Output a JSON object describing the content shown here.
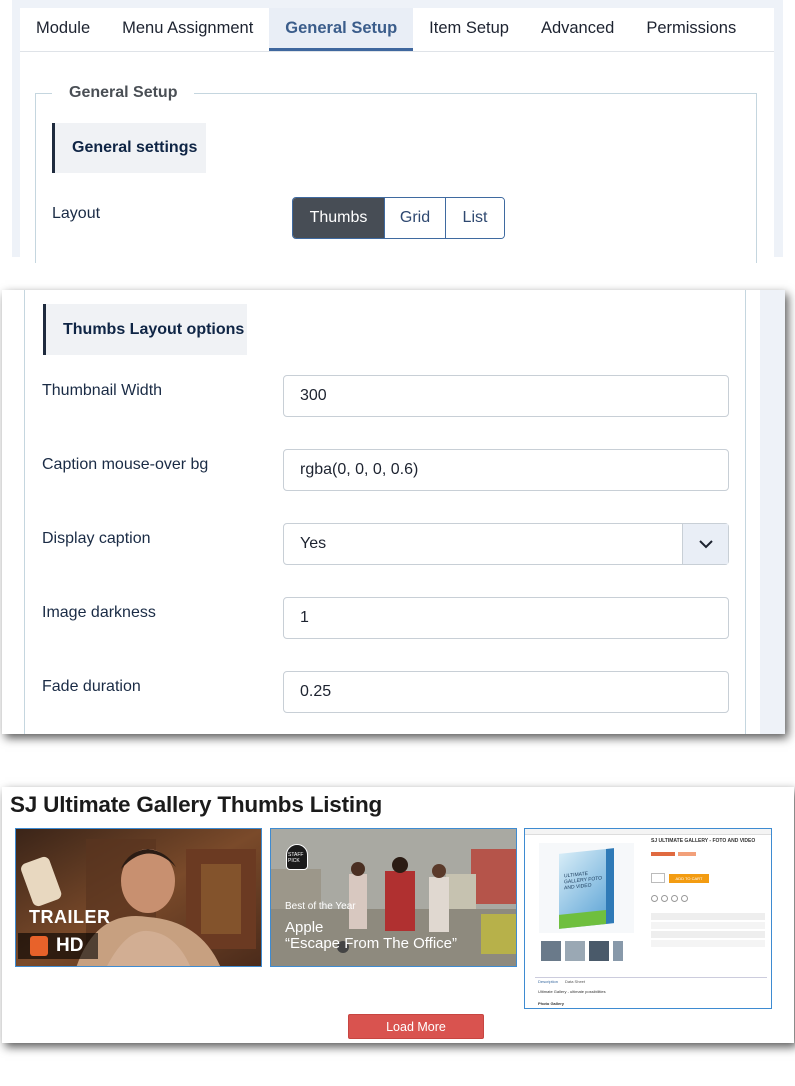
{
  "tabs": [
    "Module",
    "Menu Assignment",
    "General Setup",
    "Item Setup",
    "Advanced",
    "Permissions"
  ],
  "active_tab": "General Setup",
  "general_setup": {
    "legend": "General Setup",
    "section_heading": "General settings",
    "layout_label": "Layout",
    "layout_options": [
      "Thumbs",
      "Grid",
      "List"
    ],
    "layout_selected": "Thumbs"
  },
  "thumbs_options": {
    "section_heading": "Thumbs Layout options",
    "fields": [
      {
        "label": "Thumbnail Width",
        "value": "300",
        "type": "text"
      },
      {
        "label": "Caption mouse-over bg",
        "value": "rgba(0, 0, 0, 0.6)",
        "type": "text"
      },
      {
        "label": "Display caption",
        "value": "Yes",
        "type": "select"
      },
      {
        "label": "Image darkness",
        "value": "1",
        "type": "text"
      },
      {
        "label": "Fade duration",
        "value": "0.25",
        "type": "text"
      }
    ]
  },
  "gallery": {
    "title": "SJ Ultimate Gallery Thumbs Listing",
    "thumb1": {
      "badge": "TRAILER",
      "hd": "HD"
    },
    "thumb2": {
      "staff_pick": "STAFF PICK",
      "line1": "Best of the Year",
      "line2": "Apple",
      "line3": "“Escape From The Office”"
    },
    "thumb3": {
      "product_title": "SJ ULTIMATE GALLERY - FOTO AND VIDEO",
      "box_label": "ULTIMATE GALLERY FOTO AND VIDEO",
      "add_to_cart": "ADD TO CART",
      "tabs": [
        "Description",
        "Data Sheet"
      ],
      "desc_title": "Ultimate Gallery - ultimate possibilities",
      "desc_sub": "Photo Gallery"
    },
    "load_more": "Load More"
  },
  "colors": {
    "accent": "#3f679e",
    "panel_bg": "#eef2f8",
    "load_more": "#d9534f",
    "thumb_border": "#3e8bd1"
  }
}
